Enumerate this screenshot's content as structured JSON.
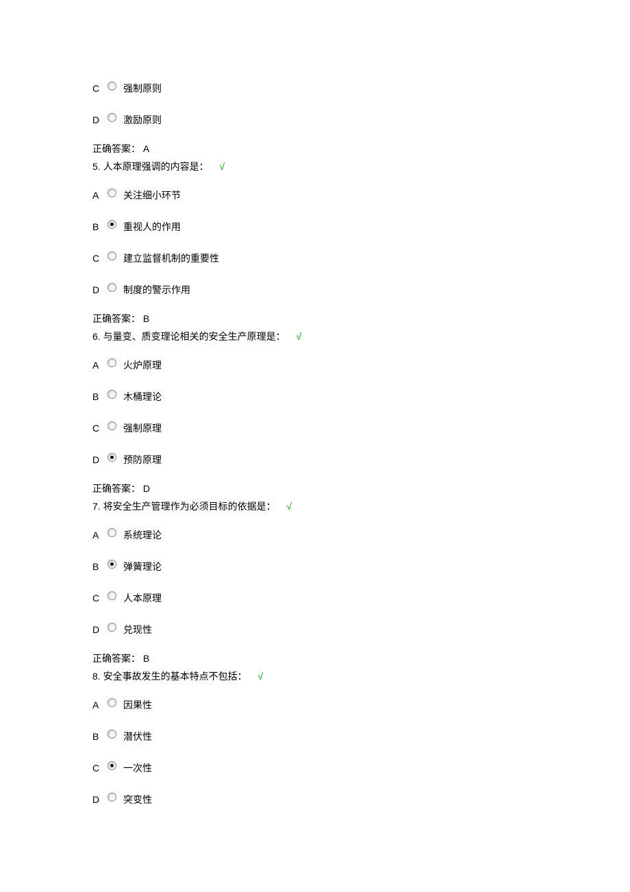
{
  "answer_prefix": "正确答案：",
  "blocks": [
    {
      "orphan_options": [
        {
          "letter": "C",
          "text": "强制原则",
          "selected": false
        },
        {
          "letter": "D",
          "text": "激励原则",
          "selected": false
        }
      ],
      "answer_letter": "A"
    },
    {
      "question_number": "5.",
      "question_text": "人本原理强调的内容是：",
      "options": [
        {
          "letter": "A",
          "text": "关注细小环节",
          "selected": false
        },
        {
          "letter": "B",
          "text": "重视人的作用",
          "selected": true
        },
        {
          "letter": "C",
          "text": "建立监督机制的重要性",
          "selected": false
        },
        {
          "letter": "D",
          "text": "制度的警示作用",
          "selected": false
        }
      ],
      "answer_letter": "B"
    },
    {
      "question_number": "6.",
      "question_text": "与量变、质变理论相关的安全生产原理是：",
      "options": [
        {
          "letter": "A",
          "text": "火炉原理",
          "selected": false
        },
        {
          "letter": "B",
          "text": "木桶理论",
          "selected": false
        },
        {
          "letter": "C",
          "text": "强制原理",
          "selected": false
        },
        {
          "letter": "D",
          "text": "预防原理",
          "selected": true
        }
      ],
      "answer_letter": "D"
    },
    {
      "question_number": "7.",
      "question_text": "将安全生产管理作为必须目标的依据是：",
      "options": [
        {
          "letter": "A",
          "text": "系统理论",
          "selected": false
        },
        {
          "letter": "B",
          "text": "弹簧理论",
          "selected": true
        },
        {
          "letter": "C",
          "text": "人本原理",
          "selected": false
        },
        {
          "letter": "D",
          "text": "兑现性",
          "selected": false
        }
      ],
      "answer_letter": "B"
    },
    {
      "question_number": "8.",
      "question_text": "安全事故发生的基本特点不包括：",
      "options": [
        {
          "letter": "A",
          "text": "因果性",
          "selected": false
        },
        {
          "letter": "B",
          "text": "潜伏性",
          "selected": false
        },
        {
          "letter": "C",
          "text": "一次性",
          "selected": true
        },
        {
          "letter": "D",
          "text": "突变性",
          "selected": false
        }
      ]
    }
  ],
  "checkmark": "√"
}
